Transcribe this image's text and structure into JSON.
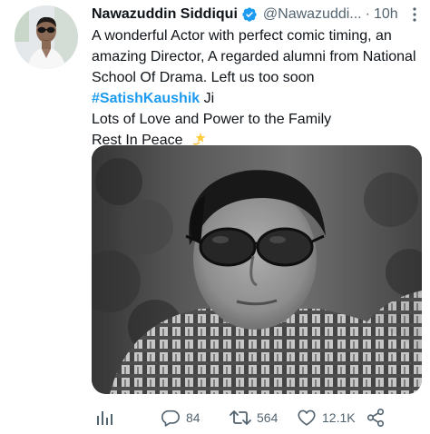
{
  "tweet": {
    "author_name": "Nawazuddin Siddiqui",
    "handle": "@Nawazuddi...",
    "dot": "·",
    "time": "10h",
    "lines": {
      "l1": "A wonderful Actor with perfect comic timing, an",
      "l2": "amazing Director, A regarded alumni from National",
      "l3": "School Of Drama. Left us too soon",
      "hashtag": "#SatishKaushik",
      "l4_suffix": " Ji",
      "l5": "Lots of Love and Power to the Family",
      "l6": "Rest In Peace"
    },
    "emoji": "dizzy-star-emoji"
  },
  "actions": {
    "replies": "84",
    "retweets": "564",
    "likes": "12.1K"
  },
  "icons": {
    "analytics": "bar-chart-icon",
    "reply": "reply-bubble-icon",
    "retweet": "retweet-icon",
    "like": "heart-icon",
    "share": "share-icon",
    "more": "more-dots-icon",
    "verified": "verified-badge-icon"
  },
  "colors": {
    "text": "#0f1419",
    "secondary": "#536471",
    "accent": "#1d9bf0",
    "verified": "#1d9bf0"
  }
}
